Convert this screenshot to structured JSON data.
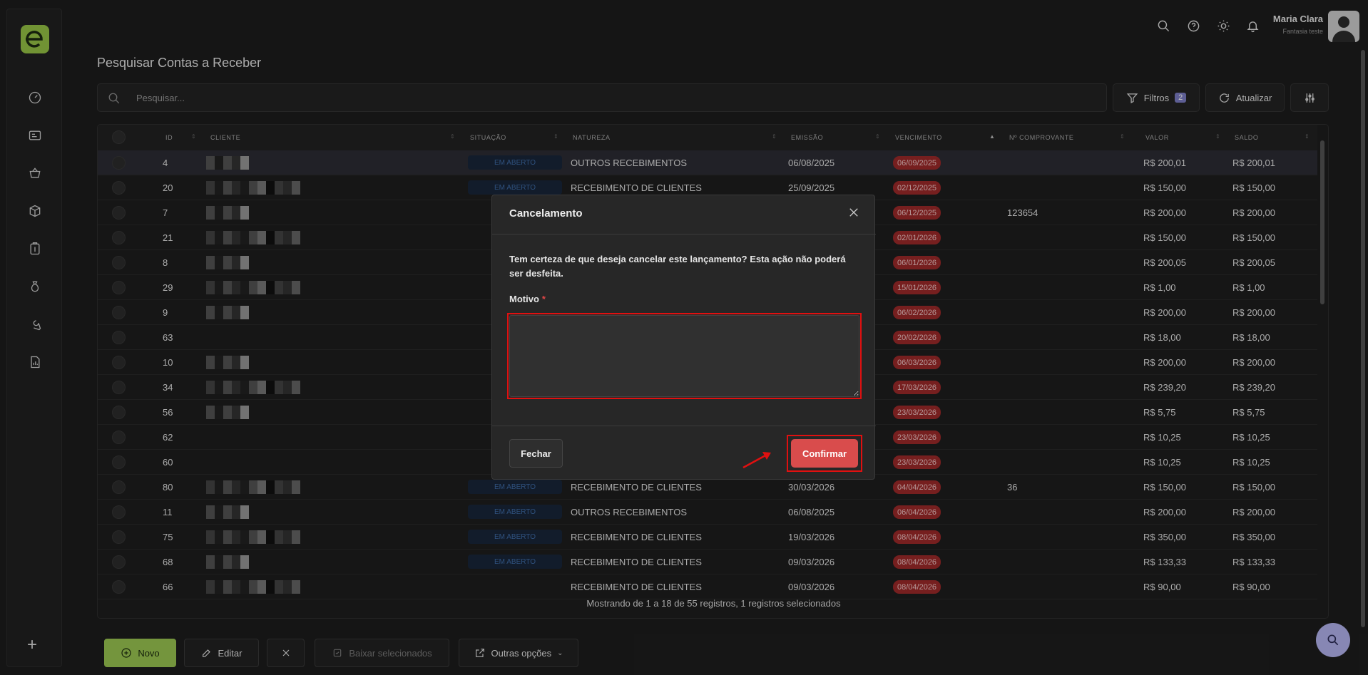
{
  "header": {
    "user_name": "Maria Clara",
    "user_sub": "Fantasia teste"
  },
  "page": {
    "title": "Pesquisar Contas a Receber"
  },
  "search": {
    "placeholder": "Pesquisar..."
  },
  "toolbar": {
    "filters_label": "Filtros",
    "filters_count": "2",
    "refresh_label": "Atualizar"
  },
  "table": {
    "columns": [
      "ID",
      "CLIENTE",
      "SITUAÇÃO",
      "NATUREZA",
      "EMISSÃO",
      "VENCIMENTO",
      "Nº COMPROVANTE",
      "VALOR",
      "SALDO"
    ],
    "rows": [
      {
        "id": "4",
        "situacao": "EM ABERTO",
        "natureza": "OUTROS RECEBIMENTOS",
        "emissao": "06/08/2025",
        "venc": "06/09/2025",
        "comp": "",
        "valor": "R$ 200,01",
        "saldo": "R$ 200,01"
      },
      {
        "id": "20",
        "situacao": "EM ABERTO",
        "natureza": "RECEBIMENTO DE CLIENTES",
        "emissao": "25/09/2025",
        "venc": "02/12/2025",
        "comp": "",
        "valor": "R$ 150,00",
        "saldo": "R$ 150,00"
      },
      {
        "id": "7",
        "situacao": "",
        "natureza": "",
        "emissao": "",
        "venc": "06/12/2025",
        "comp": "123654",
        "valor": "R$ 200,00",
        "saldo": "R$ 200,00"
      },
      {
        "id": "21",
        "situacao": "",
        "natureza": "",
        "emissao": "",
        "venc": "02/01/2026",
        "comp": "",
        "valor": "R$ 150,00",
        "saldo": "R$ 150,00"
      },
      {
        "id": "8",
        "situacao": "",
        "natureza": "",
        "emissao": "",
        "venc": "06/01/2026",
        "comp": "",
        "valor": "R$ 200,05",
        "saldo": "R$ 200,05"
      },
      {
        "id": "29",
        "situacao": "",
        "natureza": "",
        "emissao": "",
        "venc": "15/01/2026",
        "comp": "",
        "valor": "R$ 1,00",
        "saldo": "R$ 1,00"
      },
      {
        "id": "9",
        "situacao": "",
        "natureza": "",
        "emissao": "",
        "venc": "06/02/2026",
        "comp": "",
        "valor": "R$ 200,00",
        "saldo": "R$ 200,00"
      },
      {
        "id": "63",
        "situacao": "",
        "natureza": "",
        "emissao": "",
        "venc": "20/02/2026",
        "comp": "",
        "valor": "R$ 18,00",
        "saldo": "R$ 18,00"
      },
      {
        "id": "10",
        "situacao": "",
        "natureza": "",
        "emissao": "",
        "venc": "06/03/2026",
        "comp": "",
        "valor": "R$ 200,00",
        "saldo": "R$ 200,00"
      },
      {
        "id": "34",
        "situacao": "",
        "natureza": "",
        "emissao": "",
        "venc": "17/03/2026",
        "comp": "",
        "valor": "R$ 239,20",
        "saldo": "R$ 239,20"
      },
      {
        "id": "56",
        "situacao": "",
        "natureza": "",
        "emissao": "",
        "venc": "23/03/2026",
        "comp": "",
        "valor": "R$ 5,75",
        "saldo": "R$ 5,75"
      },
      {
        "id": "62",
        "situacao": "",
        "natureza": "",
        "emissao": "",
        "venc": "23/03/2026",
        "comp": "",
        "valor": "R$ 10,25",
        "saldo": "R$ 10,25"
      },
      {
        "id": "60",
        "situacao": "",
        "natureza": "",
        "emissao": "",
        "venc": "23/03/2026",
        "comp": "",
        "valor": "R$ 10,25",
        "saldo": "R$ 10,25"
      },
      {
        "id": "80",
        "situacao": "EM ABERTO",
        "natureza": "RECEBIMENTO DE CLIENTES",
        "emissao": "30/03/2026",
        "venc": "04/04/2026",
        "comp": "36",
        "valor": "R$ 150,00",
        "saldo": "R$ 150,00"
      },
      {
        "id": "11",
        "situacao": "EM ABERTO",
        "natureza": "OUTROS RECEBIMENTOS",
        "emissao": "06/08/2025",
        "venc": "06/04/2026",
        "comp": "",
        "valor": "R$ 200,00",
        "saldo": "R$ 200,00"
      },
      {
        "id": "75",
        "situacao": "EM ABERTO",
        "natureza": "RECEBIMENTO DE CLIENTES",
        "emissao": "19/03/2026",
        "venc": "08/04/2026",
        "comp": "",
        "valor": "R$ 350,00",
        "saldo": "R$ 350,00"
      },
      {
        "id": "68",
        "situacao": "EM ABERTO",
        "natureza": "RECEBIMENTO DE CLIENTES",
        "emissao": "09/03/2026",
        "venc": "08/04/2026",
        "comp": "",
        "valor": "R$ 133,33",
        "saldo": "R$ 133,33"
      },
      {
        "id": "66",
        "situacao": "",
        "natureza": "RECEBIMENTO DE CLIENTES",
        "emissao": "09/03/2026",
        "venc": "08/04/2026",
        "comp": "",
        "valor": "R$ 90,00",
        "saldo": "R$ 90,00"
      }
    ],
    "footer": "Mostrando de 1 a 18 de 55 registros, 1 registros selecionados"
  },
  "modal": {
    "title": "Cancelamento",
    "message": "Tem certeza de que deseja cancelar este lançamento? Esta ação não poderá ser desfeita.",
    "motivo_label": "Motivo",
    "required_mark": "*",
    "motivo_value": "",
    "close_label": "Fechar",
    "confirm_label": "Confirmar"
  },
  "actions": {
    "novo": "Novo",
    "editar": "Editar",
    "baixar": "Baixar selecionados",
    "outras": "Outras opções"
  },
  "colors": {
    "accent": "#97c446",
    "danger": "#d94c4c",
    "highlight": "#e01010",
    "fab": "#b4b5f0"
  }
}
